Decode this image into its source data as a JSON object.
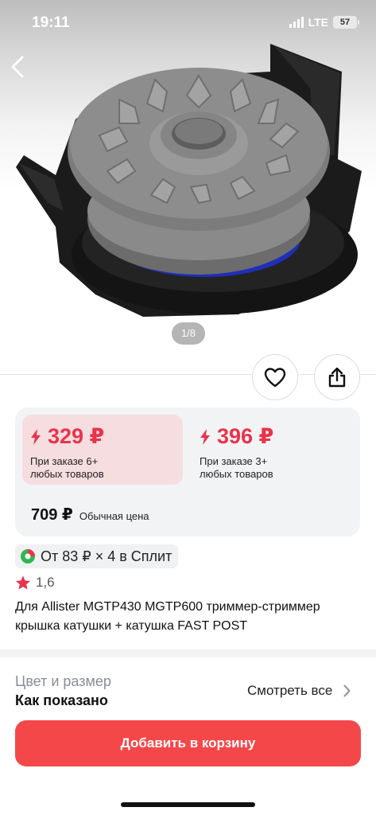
{
  "status_bar": {
    "time": "19:11",
    "network": "LTE",
    "battery": "57"
  },
  "gallery": {
    "pager": "1/8"
  },
  "prices": {
    "offers": [
      {
        "price": "329 ₽",
        "caption_line1": "При заказе 6+",
        "caption_line2": "любых товаров"
      },
      {
        "price": "396 ₽",
        "caption_line1": "При заказе 3+",
        "caption_line2": "любых товаров"
      }
    ],
    "regular_price": "709 ₽",
    "regular_label": "Обычная цена",
    "accent_color": "#e8344b"
  },
  "split": {
    "text": "От 83 ₽ × 4 в Сплит"
  },
  "rating": {
    "value": "1,6"
  },
  "product": {
    "title": "Для Allister MGTP430 MGTP600 триммер-стриммер крышка катушки + катушка FAST POST"
  },
  "variant": {
    "label": "Цвет и размер",
    "value": "Как показано",
    "see_all": "Смотреть все"
  },
  "cart_button": {
    "label": "Добавить в корзину",
    "color": "#f4474a"
  },
  "icons": [
    "back-arrow-icon",
    "heart-icon",
    "share-icon",
    "lightning-icon",
    "split-icon",
    "star-icon",
    "chevron-right-icon"
  ]
}
